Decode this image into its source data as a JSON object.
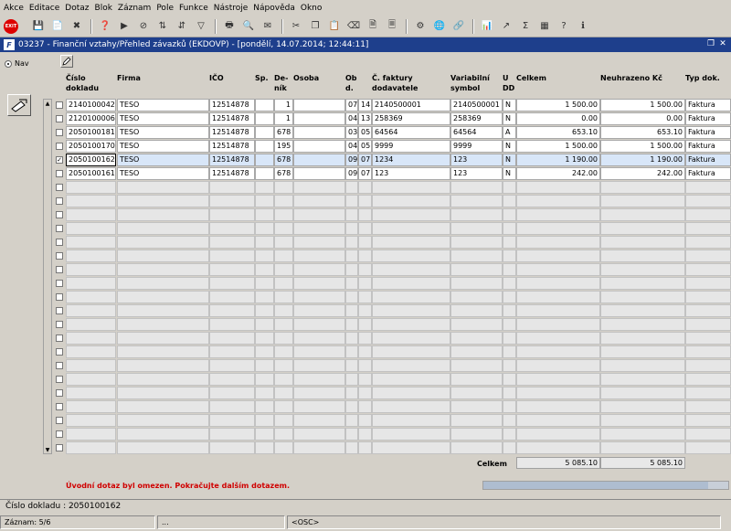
{
  "menu": [
    "Akce",
    "Editace",
    "Dotaz",
    "Blok",
    "Záznam",
    "Pole",
    "Funkce",
    "Nástroje",
    "Nápověda",
    "Okno"
  ],
  "toolbar": {
    "exit_label": "EXIT",
    "icons": [
      "save-icon",
      "new-record-icon",
      "delete-record-icon",
      "enter-query-icon",
      "execute-query-icon",
      "cancel-query-icon",
      "sort-icon",
      "sort-desc-icon",
      "filter-icon",
      "print-icon",
      "print-preview-icon",
      "mail-icon",
      "cut-icon",
      "copy-icon",
      "paste-icon",
      "clear-icon",
      "document-icon",
      "page-icon",
      "settings-icon",
      "globe-icon",
      "link-icon",
      "report-icon",
      "export-icon",
      "sum-icon",
      "excel-icon",
      "help-icon",
      "info-icon"
    ]
  },
  "window": {
    "title": "03237 - Finanční vztahy/Přehled závazků (EKDOVP) - [pondělí, 14.07.2014; 12:44:11]",
    "restore_glyph": "❐",
    "close_glyph": "✕"
  },
  "left": {
    "nav_label": "Nav"
  },
  "columns": {
    "doklad": "Číslo dokladu",
    "firma": "Firma",
    "ico": "IČO",
    "sp": "Sp.",
    "denik": "De-ník",
    "osoba": "Osoba",
    "ob": "Ob d.",
    "cfaktury": "Č. faktury dodavatele",
    "varsym": "Variabilní symbol",
    "udd": "U DD",
    "celkem": "Celkem",
    "neuhrazeno": "Neuhrazeno Kč",
    "typ": "Typ dok."
  },
  "rows": [
    {
      "checked": false,
      "selected": false,
      "doklad": "2140100042",
      "firma": "TESO",
      "ico": "12514878",
      "sp": "",
      "denik": "1",
      "osoba": "",
      "ob1": "07",
      "ob2": "14",
      "cfaktury": "2140500001",
      "varsym": "2140500001",
      "udd": "N",
      "celkem": "1 500.00",
      "neuhrazeno": "1 500.00",
      "typ": "Faktura"
    },
    {
      "checked": false,
      "selected": false,
      "doklad": "2120100006",
      "firma": "TESO",
      "ico": "12514878",
      "sp": "",
      "denik": "1",
      "osoba": "",
      "ob1": "04",
      "ob2": "13",
      "cfaktury": "258369",
      "varsym": "258369",
      "udd": "N",
      "celkem": "0.00",
      "neuhrazeno": "0.00",
      "typ": "Faktura"
    },
    {
      "checked": false,
      "selected": false,
      "doklad": "2050100181",
      "firma": "TESO",
      "ico": "12514878",
      "sp": "",
      "denik": "678",
      "osoba": "",
      "ob1": "03",
      "ob2": "05",
      "cfaktury": "64564",
      "varsym": "64564",
      "udd": "A",
      "celkem": "653.10",
      "neuhrazeno": "653.10",
      "typ": "Faktura"
    },
    {
      "checked": false,
      "selected": false,
      "doklad": "2050100170",
      "firma": "TESO",
      "ico": "12514878",
      "sp": "",
      "denik": "195",
      "osoba": "",
      "ob1": "04",
      "ob2": "05",
      "cfaktury": "9999",
      "varsym": "9999",
      "udd": "N",
      "celkem": "1 500.00",
      "neuhrazeno": "1 500.00",
      "typ": "Faktura"
    },
    {
      "checked": true,
      "selected": true,
      "doklad": "2050100162",
      "firma": "TESO",
      "ico": "12514878",
      "sp": "",
      "denik": "678",
      "osoba": "",
      "ob1": "09",
      "ob2": "07",
      "cfaktury": "1234",
      "varsym": "123",
      "udd": "N",
      "celkem": "1 190.00",
      "neuhrazeno": "1 190.00",
      "typ": "Faktura"
    },
    {
      "checked": false,
      "selected": false,
      "doklad": "2050100161",
      "firma": "TESO",
      "ico": "12514878",
      "sp": "",
      "denik": "678",
      "osoba": "",
      "ob1": "09",
      "ob2": "07",
      "cfaktury": "123",
      "varsym": "123",
      "udd": "N",
      "celkem": "242.00",
      "neuhrazeno": "242.00",
      "typ": "Faktura"
    }
  ],
  "totals": {
    "label": "Celkem",
    "celkem": "5 085.10",
    "neuhrazeno": "5 085.10"
  },
  "message": "Úvodní dotaz byl omezen. Pokračujte dalším dotazem.",
  "status": {
    "field": "Číslo dokladu : 2050100162",
    "record": "Záznam: 5/6",
    "seg2": "...",
    "mode": "<OSC>"
  }
}
